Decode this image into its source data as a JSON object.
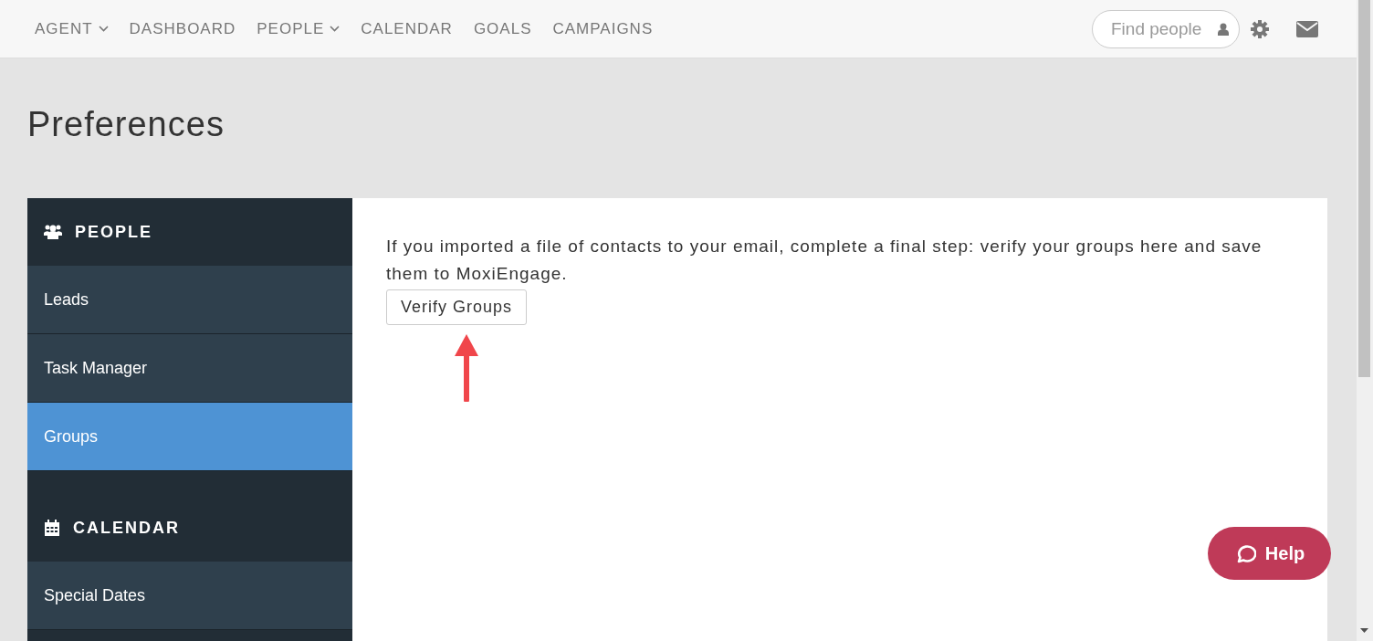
{
  "nav": {
    "items": [
      {
        "label": "AGENT",
        "dropdown": true
      },
      {
        "label": "DASHBOARD",
        "dropdown": false
      },
      {
        "label": "PEOPLE",
        "dropdown": true
      },
      {
        "label": "CALENDAR",
        "dropdown": false
      },
      {
        "label": "GOALS",
        "dropdown": false
      },
      {
        "label": "CAMPAIGNS",
        "dropdown": false
      }
    ],
    "search": {
      "placeholder": "Find people"
    }
  },
  "page_title": "Preferences",
  "sidebar": {
    "sections": [
      {
        "title": "PEOPLE",
        "items": [
          {
            "label": "Leads",
            "selected": false
          },
          {
            "label": "Task Manager",
            "selected": false
          },
          {
            "label": "Groups",
            "selected": true
          }
        ]
      },
      {
        "title": "CALENDAR",
        "items": [
          {
            "label": "Special Dates",
            "selected": false
          }
        ]
      }
    ]
  },
  "content": {
    "text": "If you imported a file of contacts to your email, complete a final step: verify your groups here and save them to MoxiEngage.",
    "button": "Verify Groups"
  },
  "help_button": "Help"
}
